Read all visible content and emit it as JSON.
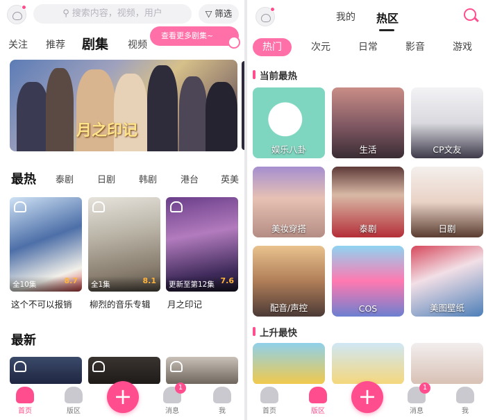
{
  "left": {
    "search_placeholder": "搜索内容，视频，用户",
    "filter_label": "筛选",
    "top_tabs": [
      "关注",
      "推荐",
      "剧集",
      "视频"
    ],
    "active_tab": "剧集",
    "promo_bubble": "查看更多剧集~",
    "banner_title": "月之印记",
    "hot_heading": "最热",
    "categories": [
      "泰剧",
      "日剧",
      "韩剧",
      "港台",
      "英美"
    ],
    "hot_items": [
      {
        "status": "全10集",
        "score": "8.7",
        "title": "这个不可以报销"
      },
      {
        "status": "全1集",
        "score": "8.1",
        "title": "柳烈的音乐专辑"
      },
      {
        "status": "更新至第12集",
        "score": "7.6",
        "title": "月之印记"
      }
    ],
    "new_heading": "最新"
  },
  "right": {
    "top_tabs": [
      "我的",
      "热区"
    ],
    "active_tab": "热区",
    "chips": [
      "热门",
      "次元",
      "日常",
      "影音",
      "游戏"
    ],
    "active_chip": "热门",
    "section_hot": "当前最热",
    "tiles": [
      "娱乐八卦",
      "生活",
      "CP文友",
      "美妆穿搭",
      "泰剧",
      "日剧",
      "配音/声控",
      "COS",
      "美图壁纸"
    ],
    "section_rising": "上升最快"
  },
  "nav": {
    "home": "首页",
    "board": "版区",
    "messages": "消息",
    "me": "我",
    "badge": "1"
  },
  "colors": {
    "accent": "#ff4d8d",
    "accent_light": "#ff6fa8"
  }
}
